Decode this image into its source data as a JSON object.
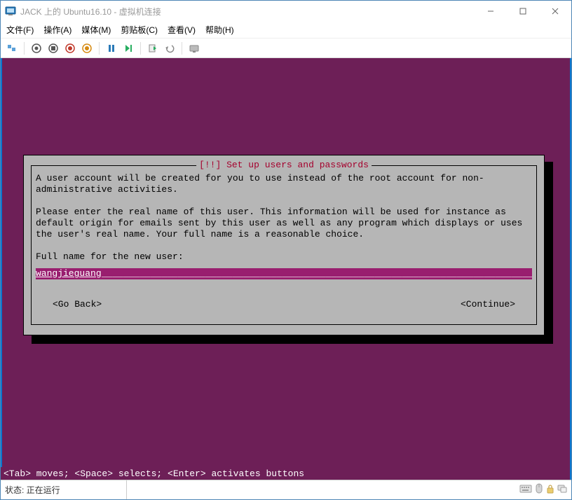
{
  "window": {
    "title": "JACK 上的 Ubuntu16.10 - 虚拟机连接"
  },
  "menu": {
    "items": [
      "文件(F)",
      "操作(A)",
      "媒体(M)",
      "剪贴板(C)",
      "查看(V)",
      "帮助(H)"
    ]
  },
  "installer": {
    "title": "[!!] Set up users and passwords",
    "body1": "A user account will be created for you to use instead of the root account for non-administrative activities.",
    "body2": "Please enter the real name of this user. This information will be used for instance as default origin for emails sent by this user as well as any program which displays or uses the user's real name. Your full name is a reasonable choice.",
    "label": "Full name for the new user:",
    "value": "wangjieguang",
    "go_back": "<Go Back>",
    "continue": "<Continue>"
  },
  "help": "<Tab> moves; <Space> selects; <Enter> activates buttons",
  "status": {
    "text": "状态: 正在运行"
  }
}
